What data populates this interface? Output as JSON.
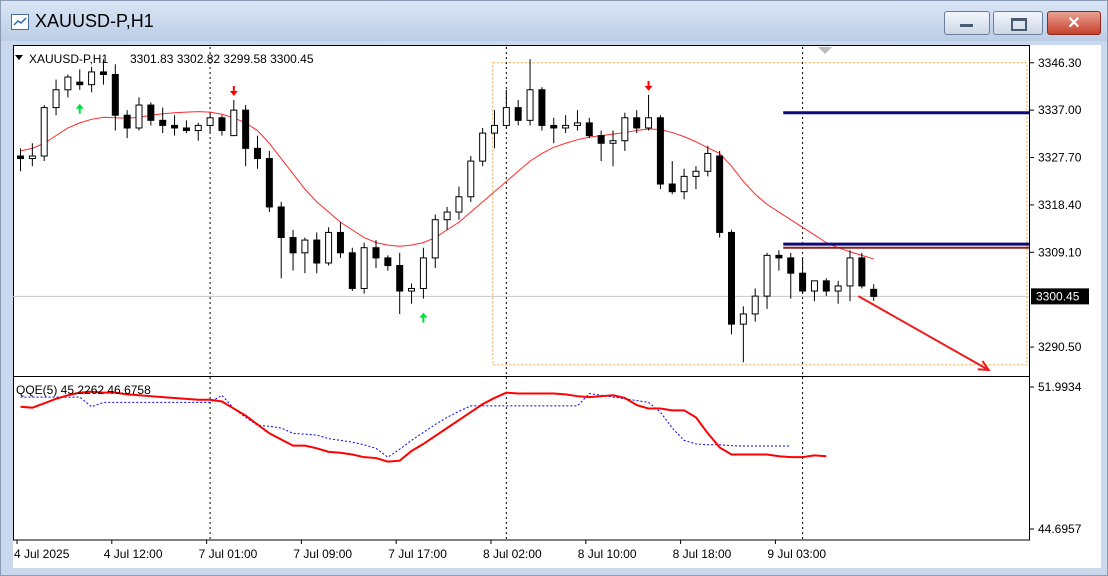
{
  "window": {
    "title": "XAUUSD-P,H1",
    "close_glyph": "✕"
  },
  "colors": {
    "bull_candle": "#ffffff",
    "bear_candle": "#000000",
    "moving_average": "#ff2a2a",
    "qqe_main": "#ff0000",
    "qqe_signal": "#0000ff",
    "level_lines": "#0a0a7a",
    "arrow_up": "#00e040",
    "arrow_down": "#ff0000"
  },
  "chart_data": [
    {
      "type": "candlestick",
      "title": "XAUUSD-P,H1",
      "ohlc_header": "3301.83 3302.82 3299.58 3300.45",
      "current_price": "3300.45",
      "y_ticks": [
        "3346.30",
        "3337.00",
        "3327.70",
        "3318.40",
        "3309.10",
        "3290.50"
      ],
      "y_tick_values": [
        3346.3,
        3337.0,
        3327.7,
        3318.4,
        3309.1,
        3290.5
      ],
      "ylim": [
        3286.0,
        3349.0
      ],
      "x_ticks": [
        "4 Jul 2025",
        "4 Jul 12:00",
        "7 Jul 01:00",
        "7 Jul 09:00",
        "7 Jul 17:00",
        "8 Jul 02:00",
        "8 Jul 10:00",
        "8 Jul 18:00",
        "9 Jul 03:00"
      ],
      "x_tick_index": [
        0,
        8,
        16,
        24,
        32,
        40,
        48,
        56,
        64
      ],
      "candles": [
        [
          3328.0,
          3329.5,
          3325.0,
          3327.5
        ],
        [
          3327.5,
          3330.5,
          3326.0,
          3328.0
        ],
        [
          3328.0,
          3338.0,
          3327.0,
          3337.5
        ],
        [
          3337.5,
          3343.0,
          3336.0,
          3341.0
        ],
        [
          3341.0,
          3344.0,
          3339.5,
          3343.5
        ],
        [
          3342.5,
          3345.0,
          3341.0,
          3342.0
        ],
        [
          3342.0,
          3345.5,
          3340.5,
          3344.5
        ],
        [
          3344.5,
          3347.0,
          3342.0,
          3344.0
        ],
        [
          3344.0,
          3346.0,
          3333.0,
          3336.0
        ],
        [
          3336.0,
          3337.0,
          3331.5,
          3333.5
        ],
        [
          3333.5,
          3339.5,
          3333.0,
          3338.0
        ],
        [
          3338.0,
          3338.5,
          3334.0,
          3335.0
        ],
        [
          3335.0,
          3337.5,
          3332.5,
          3334.0
        ],
        [
          3334.0,
          3336.0,
          3332.0,
          3333.5
        ],
        [
          3333.5,
          3335.0,
          3332.5,
          3333.0
        ],
        [
          3333.0,
          3334.5,
          3331.0,
          3334.0
        ],
        [
          3334.0,
          3336.5,
          3332.5,
          3335.5
        ],
        [
          3335.5,
          3336.0,
          3332.0,
          3333.0
        ],
        [
          3332.0,
          3339.0,
          3332.0,
          3337.0
        ],
        [
          3337.0,
          3338.0,
          3326.0,
          3329.5
        ],
        [
          3329.5,
          3332.0,
          3325.5,
          3327.5
        ],
        [
          3327.5,
          3329.0,
          3317.0,
          3318.0
        ],
        [
          3318.0,
          3319.0,
          3304.0,
          3312.0
        ],
        [
          3312.0,
          3313.5,
          3305.5,
          3309.0
        ],
        [
          3309.0,
          3312.0,
          3305.0,
          3311.5
        ],
        [
          3311.5,
          3313.0,
          3305.0,
          3307.0
        ],
        [
          3307.0,
          3314.0,
          3306.5,
          3313.0
        ],
        [
          3313.0,
          3315.0,
          3308.0,
          3309.0
        ],
        [
          3309.0,
          3310.0,
          3301.5,
          3302.0
        ],
        [
          3302.0,
          3311.0,
          3301.0,
          3310.0
        ],
        [
          3310.0,
          3311.5,
          3306.0,
          3308.0
        ],
        [
          3308.0,
          3308.5,
          3305.5,
          3306.5
        ],
        [
          3306.5,
          3309.0,
          3297.0,
          3301.5
        ],
        [
          3301.5,
          3303.0,
          3299.0,
          3302.0
        ],
        [
          3302.0,
          3310.0,
          3300.0,
          3308.0
        ],
        [
          3308.0,
          3316.5,
          3306.0,
          3315.5
        ],
        [
          3315.5,
          3318.0,
          3313.5,
          3317.0
        ],
        [
          3317.0,
          3322.0,
          3315.5,
          3320.0
        ],
        [
          3320.0,
          3328.0,
          3319.0,
          3327.0
        ],
        [
          3327.0,
          3333.5,
          3326.0,
          3332.5
        ],
        [
          3332.5,
          3337.0,
          3329.5,
          3334.0
        ],
        [
          3334.0,
          3341.0,
          3333.5,
          3337.5
        ],
        [
          3337.5,
          3339.0,
          3334.0,
          3335.0
        ],
        [
          3335.0,
          3347.0,
          3334.0,
          3341.0
        ],
        [
          3341.0,
          3341.5,
          3333.0,
          3334.0
        ],
        [
          3334.0,
          3335.5,
          3330.5,
          3333.5
        ],
        [
          3333.5,
          3336.0,
          3332.5,
          3334.0
        ],
        [
          3334.0,
          3337.0,
          3333.0,
          3334.5
        ],
        [
          3334.5,
          3335.5,
          3331.5,
          3332.0
        ],
        [
          3332.0,
          3333.0,
          3327.0,
          3330.5
        ],
        [
          3330.5,
          3333.0,
          3326.0,
          3331.0
        ],
        [
          3331.0,
          3336.5,
          3329.0,
          3335.5
        ],
        [
          3335.5,
          3337.0,
          3332.5,
          3333.5
        ],
        [
          3333.5,
          3340.0,
          3333.0,
          3335.5
        ],
        [
          3335.5,
          3336.0,
          3321.5,
          3322.5
        ],
        [
          3322.5,
          3327.0,
          3320.5,
          3321.0
        ],
        [
          3321.0,
          3325.5,
          3319.5,
          3324.0
        ],
        [
          3324.0,
          3326.0,
          3321.5,
          3325.0
        ],
        [
          3325.0,
          3330.0,
          3324.0,
          3328.5
        ],
        [
          3328.0,
          3329.0,
          3312.0,
          3313.0
        ],
        [
          3313.0,
          3313.5,
          3293.0,
          3295.0
        ],
        [
          3295.0,
          3298.5,
          3287.5,
          3297.0
        ],
        [
          3297.0,
          3302.0,
          3295.5,
          3300.5
        ],
        [
          3300.5,
          3309.0,
          3298.0,
          3308.5
        ],
        [
          3308.5,
          3309.5,
          3305.5,
          3308.0
        ],
        [
          3308.0,
          3309.0,
          3300.0,
          3305.0
        ],
        [
          3305.0,
          3308.0,
          3301.0,
          3301.5
        ],
        [
          3301.5,
          3303.0,
          3299.5,
          3303.5
        ],
        [
          3303.5,
          3304.0,
          3300.5,
          3301.5
        ],
        [
          3301.5,
          3303.5,
          3299.0,
          3302.5
        ],
        [
          3302.5,
          3309.5,
          3299.5,
          3308.0
        ],
        [
          3308.0,
          3309.0,
          3302.0,
          3302.5
        ],
        [
          3301.83,
          3302.82,
          3299.58,
          3300.45
        ]
      ],
      "moving_average": [
        3329.0,
        3329.5,
        3330.5,
        3332.0,
        3333.5,
        3334.5,
        3335.2,
        3335.6,
        3335.5,
        3335.4,
        3335.6,
        3336.0,
        3336.3,
        3336.5,
        3336.6,
        3336.7,
        3336.6,
        3336.2,
        3335.5,
        3334.5,
        3333.0,
        3330.5,
        3327.5,
        3324.5,
        3321.5,
        3319.0,
        3317.0,
        3315.0,
        3313.5,
        3312.0,
        3311.0,
        3310.5,
        3310.3,
        3310.5,
        3311.0,
        3312.0,
        3313.5,
        3315.0,
        3317.0,
        3319.0,
        3321.0,
        3323.0,
        3325.0,
        3327.0,
        3328.5,
        3329.7,
        3330.5,
        3331.2,
        3331.7,
        3332.0,
        3332.3,
        3332.6,
        3333.0,
        3333.3,
        3333.2,
        3332.6,
        3331.8,
        3330.8,
        3329.6,
        3328.5,
        3326.0,
        3323.0,
        3320.5,
        3318.5,
        3317.0,
        3315.5,
        3314.0,
        3312.5,
        3311.0,
        3310.0,
        3309.2,
        3308.5,
        3307.8
      ],
      "arrows_up_at": [
        5,
        34
      ],
      "arrows_down_at": [
        18,
        53
      ],
      "levels": [
        3336.5,
        3310.7,
        3310.0
      ],
      "level_start_index": 65,
      "range_box": {
        "top": 3346.3,
        "bottom": 3287.0,
        "start_index": 41
      },
      "trend_arrow": {
        "from_index": 71,
        "from_price": 3300.5,
        "to_index": 82,
        "to_price": 3286.0
      },
      "vlines_at": [
        16,
        41,
        66
      ]
    },
    {
      "type": "line",
      "title": "QQE(5) 45.2262 46.6758",
      "y_ticks": [
        "51.9934",
        "44.6957"
      ],
      "y_tick_values": [
        51.9934,
        44.6957
      ],
      "ylim": [
        44.6957,
        51.9934
      ],
      "series": [
        {
          "values": [
            51.1,
            51.05,
            51.3,
            51.55,
            51.75,
            51.9,
            51.95,
            51.9,
            51.9,
            51.8,
            51.75,
            51.7,
            51.65,
            51.6,
            51.55,
            51.5,
            51.5,
            51.4,
            51.0,
            50.6,
            50.1,
            49.6,
            49.25,
            48.9,
            48.9,
            48.75,
            48.55,
            48.5,
            48.4,
            48.25,
            48.2,
            48.0,
            48.05,
            48.6,
            49.0,
            49.45,
            49.9,
            50.35,
            50.8,
            51.25,
            51.6,
            51.9,
            51.85,
            51.85,
            51.85,
            51.85,
            51.8,
            51.7,
            51.65,
            51.7,
            51.75,
            51.6,
            51.2,
            51.0,
            51.0,
            50.9,
            50.9,
            50.5,
            49.6,
            48.8,
            48.4,
            48.4,
            48.4,
            48.4,
            48.3,
            48.25,
            48.25,
            48.35,
            48.3
          ]
        },
        {
          "values": [
            51.65,
            51.65,
            51.65,
            51.65,
            51.65,
            51.65,
            51.1,
            51.35,
            51.35,
            51.35,
            51.35,
            51.35,
            51.35,
            51.35,
            51.35,
            51.35,
            51.35,
            51.75,
            51.0,
            50.5,
            50.05,
            50.0,
            49.9,
            49.6,
            49.55,
            49.5,
            49.3,
            49.2,
            49.1,
            48.95,
            48.75,
            48.25,
            48.7,
            49.2,
            49.65,
            50.1,
            50.5,
            50.85,
            51.15,
            51.15,
            51.15,
            51.15,
            51.15,
            51.15,
            51.15,
            51.15,
            51.15,
            51.15,
            51.85,
            51.75,
            51.65,
            51.55,
            51.45,
            51.35,
            50.8,
            49.9,
            49.2,
            49.0,
            48.95,
            48.95,
            48.9,
            48.88,
            48.88,
            48.88,
            48.88,
            48.88
          ]
        }
      ]
    }
  ]
}
